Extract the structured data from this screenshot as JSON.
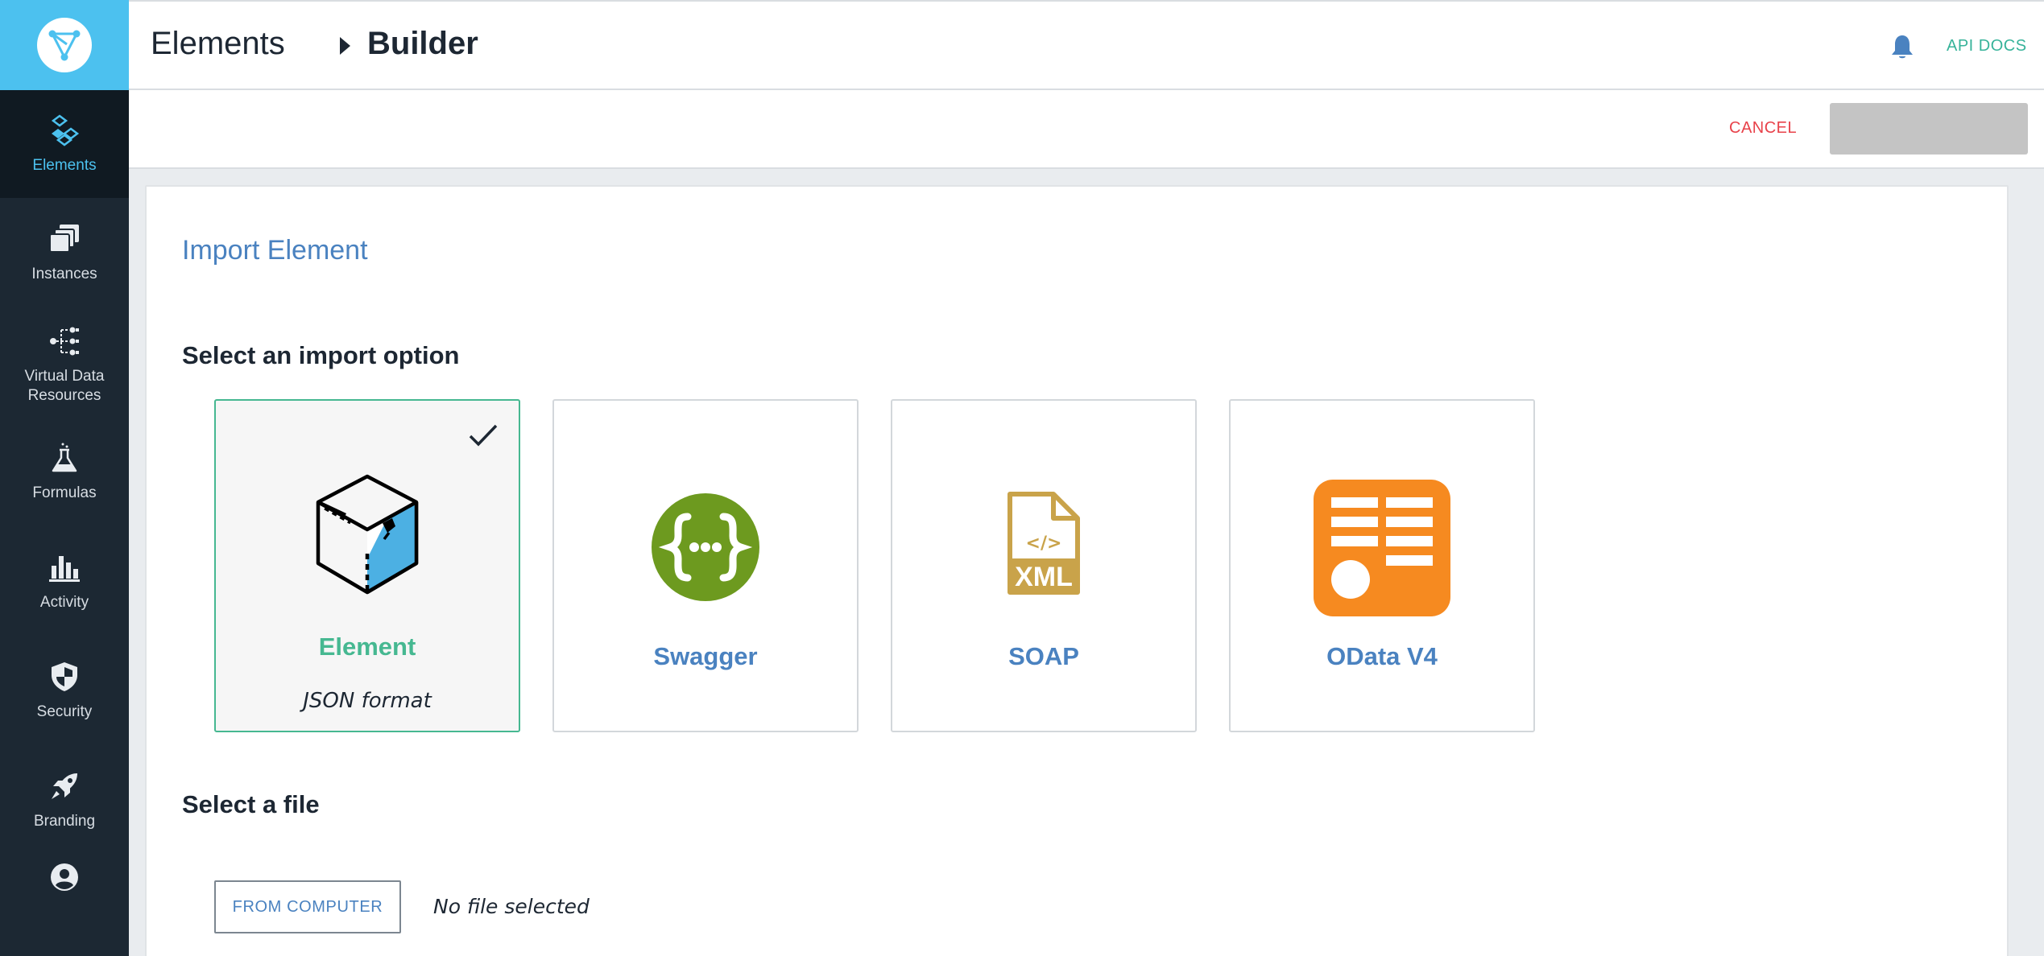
{
  "sidebar": {
    "items": [
      {
        "label": "Elements",
        "icon": "elements-icon",
        "active": true
      },
      {
        "label": "Instances",
        "icon": "instances-icon"
      },
      {
        "label": "Virtual Data\nResources",
        "icon": "virtual-data-icon"
      },
      {
        "label": "Formulas",
        "icon": "flask-icon"
      },
      {
        "label": "Activity",
        "icon": "bar-chart-icon"
      },
      {
        "label": "Security",
        "icon": "shield-icon"
      },
      {
        "label": "Branding",
        "icon": "rocket-icon"
      }
    ]
  },
  "header": {
    "breadcrumb_root": "Elements",
    "breadcrumb_current": "Builder",
    "api_docs": "API DOCS"
  },
  "actions": {
    "cancel": "CANCEL"
  },
  "content": {
    "title": "Import Element",
    "import_section": "Select an import option",
    "options": [
      {
        "label": "Element",
        "sub": "JSON format",
        "selected": true
      },
      {
        "label": "Swagger"
      },
      {
        "label": "SOAP"
      },
      {
        "label": "OData V4"
      }
    ],
    "file_section": "Select a file",
    "from_computer": "FROM COMPUTER",
    "file_status": "No file selected"
  },
  "colors": {
    "sidebar_bg": "#1c2833",
    "logo_bg": "#4cc1ef",
    "accent_blue": "#4a82c0",
    "accent_green": "#46b891",
    "cancel_red": "#e8424a",
    "swagger_green": "#6d9a1f",
    "soap_gold": "#c9a34a",
    "odata_orange": "#f68a20"
  }
}
